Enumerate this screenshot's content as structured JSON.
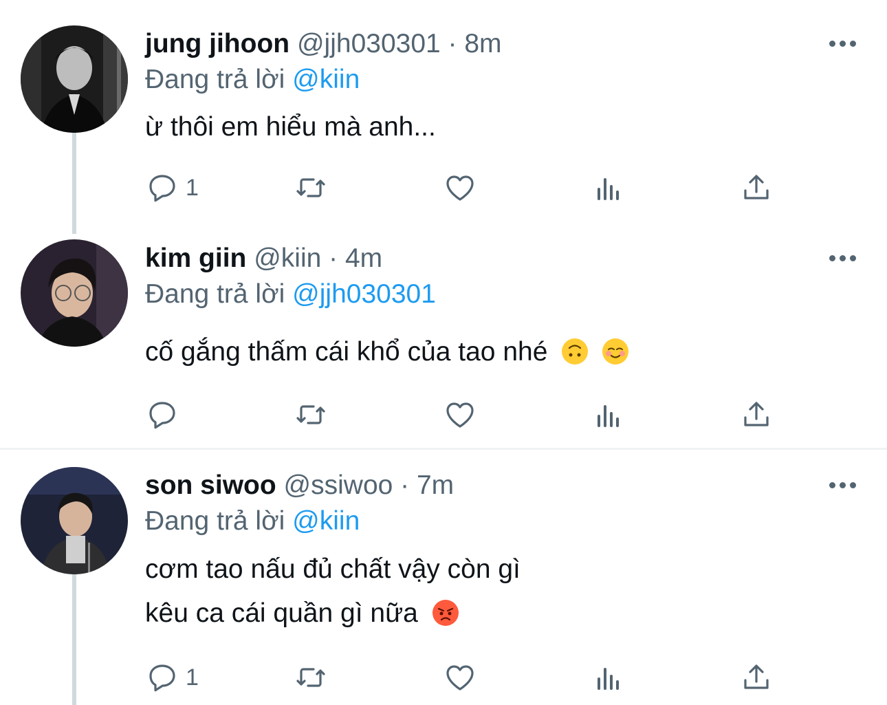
{
  "colors": {
    "accent": "#1d9bf0",
    "muted": "#536471",
    "text": "#0f1419",
    "line": "#cfd9de"
  },
  "reply_prefix": "Đang trả lời",
  "tweets": [
    {
      "name": "jung jihoon",
      "meta": "@jjh030301 · 8m",
      "mention": "@kiin",
      "lines": [
        "ừ thôi em hiểu mà anh..."
      ],
      "emojis": [],
      "reply_count": "1"
    },
    {
      "name": "kim giin",
      "meta": "@kiin · 4m",
      "mention": "@jjh030301",
      "lines": [
        "cố gắng thấm cái khổ của tao nhé"
      ],
      "emojis": [
        "upside-down-face-emoji",
        "smiling-face-emoji"
      ],
      "reply_count": ""
    },
    {
      "name": "son siwoo",
      "meta": "@ssiwoo · 7m",
      "mention": "@kiin",
      "lines": [
        "cơm tao nấu đủ chất vậy còn gì",
        "kêu ca cái quần gì nữa"
      ],
      "emojis": [
        "angry-face-emoji"
      ],
      "reply_count": "1"
    }
  ],
  "icons": [
    "more-icon",
    "reply-icon",
    "retweet-icon",
    "like-icon",
    "analytics-icon",
    "share-icon"
  ]
}
